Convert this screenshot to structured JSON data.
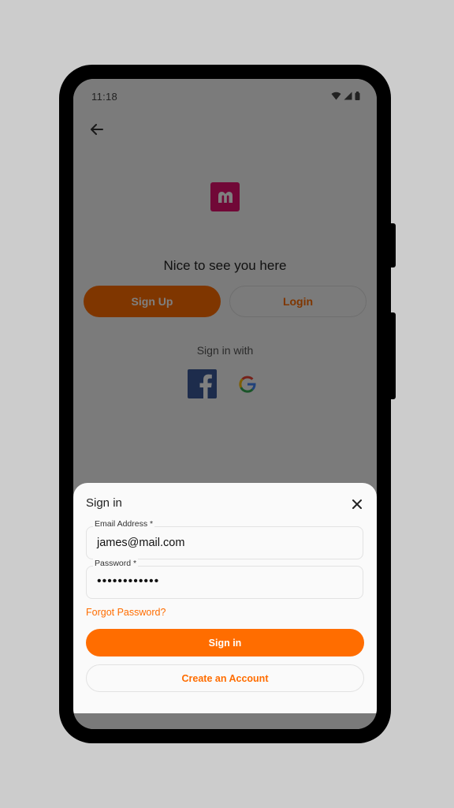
{
  "status_bar": {
    "time": "11:18",
    "icons": [
      "wifi-icon",
      "signal-icon",
      "battery-icon"
    ]
  },
  "header": {
    "back_icon": "arrow-left-icon",
    "logo_icon": "m-logo-icon"
  },
  "background_screen": {
    "greeting": "Nice to see you here",
    "signup_label": "Sign Up",
    "login_label": "Login",
    "sign_in_with": "Sign in with",
    "social": [
      "facebook-icon",
      "google-icon"
    ]
  },
  "sheet": {
    "title": "Sign in",
    "close_icon": "close-icon",
    "email": {
      "label": "Email Address *",
      "value": "james@mail.com"
    },
    "password": {
      "label": "Password *",
      "value": "••••••••••••"
    },
    "forgot_label": "Forgot Password?",
    "signin_label": "Sign in",
    "create_label": "Create an Account"
  },
  "colors": {
    "accent": "#ff6d00",
    "logo": "#e3106f",
    "facebook": "#3b5998"
  }
}
